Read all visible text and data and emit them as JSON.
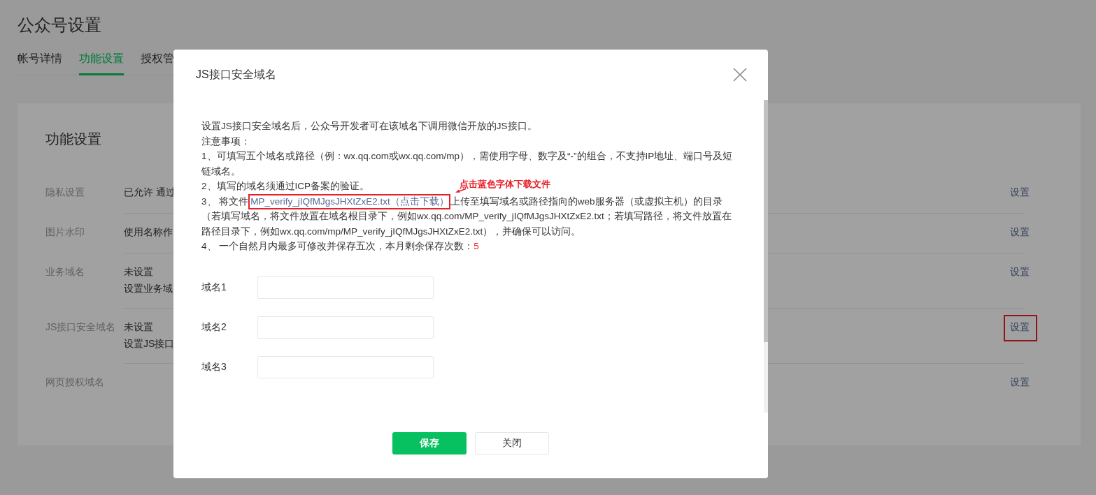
{
  "page": {
    "title": "公众号设置",
    "tabs": [
      {
        "label": "帐号详情",
        "selected": false
      },
      {
        "label": "功能设置",
        "selected": true
      },
      {
        "label": "授权管",
        "selected": false
      }
    ]
  },
  "card": {
    "title": "功能设置",
    "rows": [
      {
        "label": "隐私设置",
        "lines": [
          "已允许 通过"
        ],
        "action": "设置",
        "highlighted": false
      },
      {
        "label": "图片水印",
        "lines": [
          "使用名称作"
        ],
        "action": "设置",
        "highlighted": false
      },
      {
        "label": "业务域名",
        "lines": [
          "未设置",
          "设置业务域"
        ],
        "action": "设置",
        "highlighted": false
      },
      {
        "label": "JS接口安全域名",
        "lines": [
          "未设置",
          "设置JS接口"
        ],
        "action": "设置",
        "highlighted": true
      },
      {
        "label": "网页授权域名",
        "lines": [],
        "action": "设置",
        "highlighted": false
      }
    ]
  },
  "dialog": {
    "title": "JS接口安全域名",
    "intro": "设置JS接口安全域名后，公众号开发者可在该域名下调用微信开放的JS接口。",
    "notes_heading": "注意事项：",
    "notes": [
      {
        "kind": "text",
        "text": "1、可填写五个域名或路径（例：wx.qq.com或wx.qq.com/mp），需使用字母、数字及“-”的组合，不支持IP地址、端口号及短链域名。"
      },
      {
        "kind": "text",
        "text": "2、填写的域名须通过ICP备案的验证。"
      },
      {
        "kind": "link",
        "before": "3、 将文件",
        "link": "MP_verify_jIQfMJgsJHXtZxE2.txt（点击下载）",
        "after": "上传至填写域名或路径指向的web服务器（或虚拟主机）的目录（若填写域名，将文件放置在域名根目录下，例如wx.qq.com/MP_verify_jIQfMJgsJHXtZxE2.txt；若填写路径，将文件放置在路径目录下，例如wx.qq.com/mp/MP_verify_jIQfMJgsJHXtZxE2.txt），并确保可以访问。",
        "highlighted": true
      },
      {
        "kind": "count",
        "text": "4、 一个自然月内最多可修改并保存五次，本月剩余保存次数：",
        "count": "5"
      }
    ],
    "annotation": "点击蓝色字体下载文件",
    "fields": [
      {
        "label": "域名1"
      },
      {
        "label": "域名2"
      },
      {
        "label": "域名3"
      }
    ],
    "buttons": [
      {
        "label": "保存",
        "kind": "primary"
      },
      {
        "label": "关闭",
        "kind": "default"
      }
    ]
  }
}
